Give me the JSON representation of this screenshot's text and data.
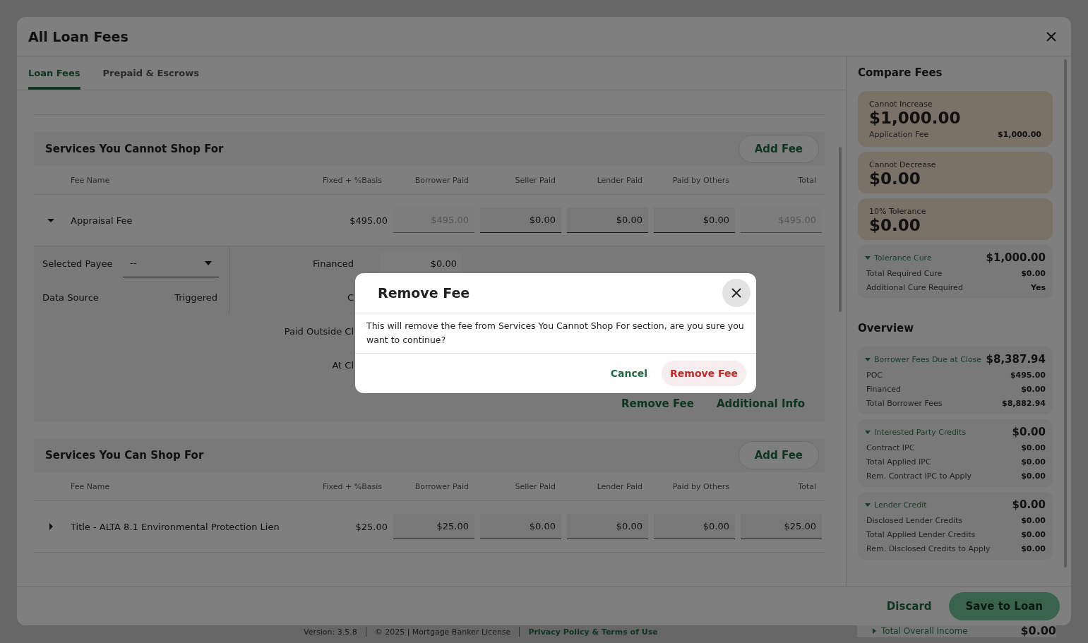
{
  "background": {
    "version": "Version: 3.5.8",
    "license": "© 2025 | Mortgage Banker License",
    "link": "Privacy Policy & Terms of Use",
    "income": {
      "label": "Total Overall Income",
      "value": "$0.00",
      "expanded": false
    }
  },
  "window": {
    "title": "All Loan Fees"
  },
  "tabs": [
    {
      "label": "Loan Fees",
      "selected": true
    },
    {
      "label": "Prepaid & Escrows",
      "selected": false
    }
  ],
  "sections": [
    {
      "title": "Services You Cannot Shop For",
      "add_button": "Add Fee",
      "columns": [
        "Fee Name",
        "Fixed + %Basis",
        "Borrower Paid",
        "Seller Paid",
        "Lender Paid",
        "Paid by Others",
        "Total"
      ],
      "rows": [
        {
          "expanded": true,
          "cells": [
            {
              "kind": "text",
              "value": "Appraisal Fee"
            },
            {
              "kind": "text",
              "value": "$495.00"
            },
            {
              "kind": "input",
              "value": "$495.00",
              "disabled": true
            },
            {
              "kind": "input",
              "value": "$0.00",
              "disabled": false
            },
            {
              "kind": "input",
              "value": "$0.00",
              "disabled": false
            },
            {
              "kind": "input",
              "value": "$0.00",
              "disabled": false
            },
            {
              "kind": "input",
              "value": "$495.00",
              "disabled": true
            }
          ],
          "details": {
            "payee_label": "Selected Payee",
            "payee_value": "--",
            "source_label": "Data Source",
            "source_value": "Triggered",
            "right_labels": [
              "Financed",
              "C",
              "Paid Outside Cl",
              "At Cl"
            ],
            "financed_value": "$0.00",
            "links": [
              "Remove Fee",
              "Additional Info"
            ]
          }
        }
      ]
    },
    {
      "title": "Services You Can Shop For",
      "add_button": "Add Fee",
      "columns": [
        "Fee Name",
        "Fixed + %Basis",
        "Borrower Paid",
        "Seller Paid",
        "Lender Paid",
        "Paid by Others",
        "Total"
      ],
      "rows": [
        {
          "expanded": false,
          "cells": [
            {
              "kind": "text",
              "value": "Title - ALTA 8.1 Environmental Protection Lien"
            },
            {
              "kind": "text",
              "value": "$25.00"
            },
            {
              "kind": "input",
              "value": "$25.00",
              "disabled": false
            },
            {
              "kind": "input",
              "value": "$0.00",
              "disabled": false
            },
            {
              "kind": "input",
              "value": "$0.00",
              "disabled": false
            },
            {
              "kind": "input",
              "value": "$0.00",
              "disabled": false
            },
            {
              "kind": "input",
              "value": "$25.00",
              "disabled": false
            }
          ]
        }
      ]
    }
  ],
  "compare_fees": {
    "title": "Compare Fees",
    "cards": [
      {
        "label": "Cannot Increase",
        "amount": "$1,000.00",
        "lines": [
          {
            "label": "Application Fee",
            "value": "$1,000.00"
          }
        ]
      },
      {
        "label": "Cannot Decrease",
        "amount": "$0.00"
      },
      {
        "label": "10% Tolerance",
        "amount": "$0.00"
      }
    ],
    "groups": [
      {
        "label": "Tolerance Cure",
        "amount": "$1,000.00",
        "expanded": true,
        "lines": [
          {
            "label": "Total Required Cure",
            "value": "$0.00"
          },
          {
            "label": "Additional Cure Required",
            "value": "Yes"
          }
        ]
      }
    ]
  },
  "overview": {
    "title": "Overview",
    "groups": [
      {
        "label": "Borrower Fees Due at Close",
        "amount": "$8,387.94",
        "expanded": true,
        "lines": [
          {
            "label": "POC",
            "value": "$495.00"
          },
          {
            "label": "Financed",
            "value": "$0.00"
          },
          {
            "label": "Total Borrower Fees",
            "value": "$8,882.94"
          }
        ]
      },
      {
        "label": "Interested Party Credits",
        "amount": "$0.00",
        "expanded": true,
        "lines": [
          {
            "label": "Contract IPC",
            "value": "$0.00"
          },
          {
            "label": "Total Applied IPC",
            "value": "$0.00"
          },
          {
            "label": "Rem. Contract IPC to Apply",
            "value": "$0.00"
          }
        ]
      },
      {
        "label": "Lender Credit",
        "amount": "$0.00",
        "expanded": true,
        "lines": [
          {
            "label": "Disclosed Lender Credits",
            "value": "$0.00"
          },
          {
            "label": "Total Applied Lender Credits",
            "value": "$0.00"
          },
          {
            "label": "Rem. Disclosed Credits to Apply",
            "value": "$0.00"
          }
        ]
      }
    ]
  },
  "footer": {
    "discard": "Discard",
    "save": "Save to Loan"
  },
  "dialog": {
    "title": "Remove Fee",
    "message": "This will remove the fee from Services You Cannot Shop For section, are you sure you want to continue?",
    "cancel": "Cancel",
    "confirm": "Remove Fee"
  }
}
